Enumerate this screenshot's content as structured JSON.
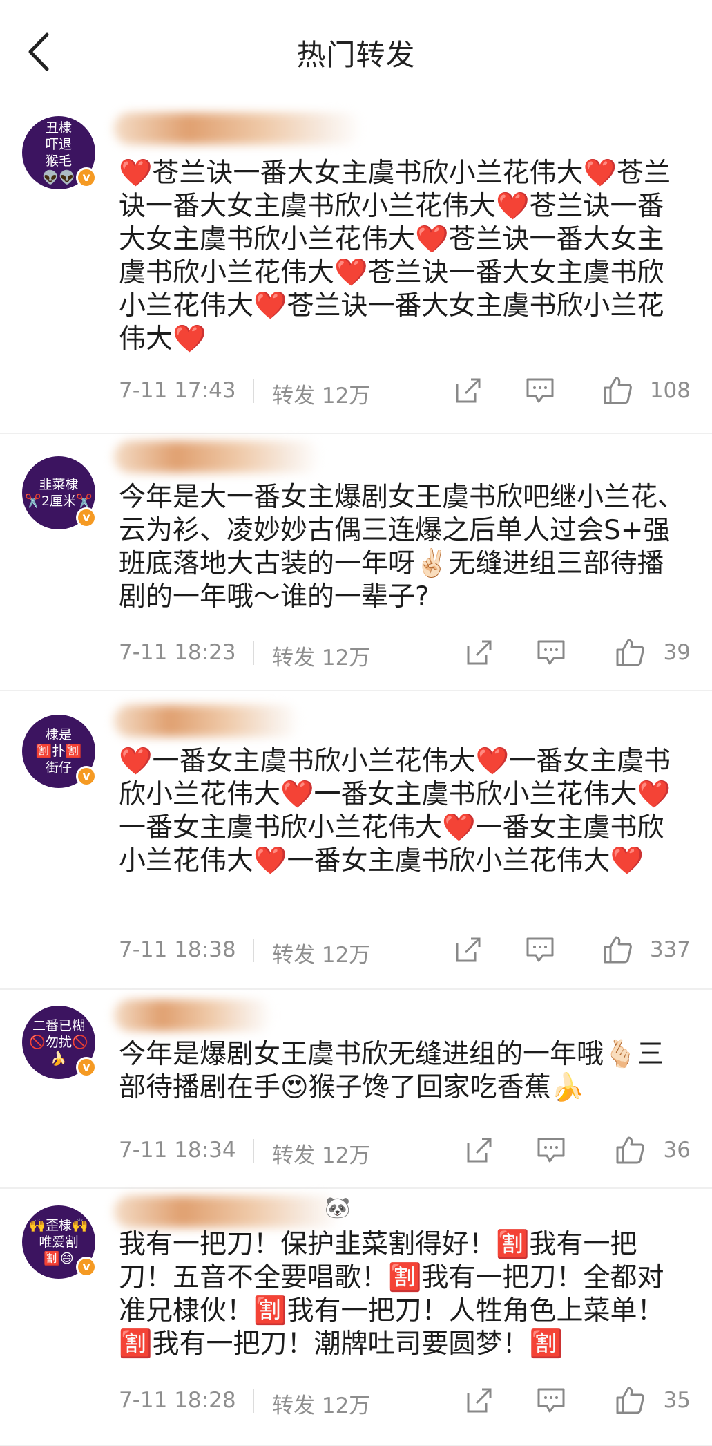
{
  "header": {
    "title": "热门转发"
  },
  "posts": [
    {
      "avatar": [
        "丑棣",
        "吓退",
        "猴毛",
        "👽👽"
      ],
      "text": "❤️苍兰诀一番大女主虞书欣小兰花伟大❤️苍兰诀一番大女主虞书欣小兰花伟大❤️苍兰诀一番大女主虞书欣小兰花伟大❤️苍兰诀一番大女主虞书欣小兰花伟大❤️苍兰诀一番大女主虞书欣小兰花伟大❤️苍兰诀一番大女主虞书欣小兰花伟大❤️",
      "time": "7-11 17:43",
      "repost": "转发 12万",
      "likes": "108"
    },
    {
      "avatar": [
        "韭菜棣",
        "✂️2厘米✂️"
      ],
      "text": "今年是大一番女主爆剧女王虞书欣吧继小兰花、云为衫、凌妙妙古偶三连爆之后单人过会S+强班底落地大古装的一年呀✌🏻无缝进组三部待播剧的一年哦～谁的一辈子?",
      "time": "7-11 18:23",
      "repost": "转发 12万",
      "likes": "39"
    },
    {
      "avatar": [
        "棣是",
        "🈹扑🈹",
        "街仔"
      ],
      "text": "❤️一番女主虞书欣小兰花伟大❤️一番女主虞书欣小兰花伟大❤️一番女主虞书欣小兰花伟大❤️一番女主虞书欣小兰花伟大❤️一番女主虞书欣小兰花伟大❤️一番女主虞书欣小兰花伟大❤️",
      "time": "7-11 18:38",
      "repost": "转发 12万",
      "likes": "337"
    },
    {
      "avatar": [
        "二番已糊",
        "🚫勿扰🚫",
        "🍌"
      ],
      "text": "今年是爆剧女王虞书欣无缝进组的一年哦🫰🏻三部待播剧在手😍猴子馋了回家吃香蕉🍌",
      "time": "7-11 18:34",
      "repost": "转发 12万",
      "likes": "36"
    },
    {
      "avatar": [
        "🙌歪棣🙌",
        "唯爱割",
        "🈹😄"
      ],
      "text": "我有一把刀！保护韭菜割得好！🈹我有一把刀！五音不全要唱歌！🈹我有一把刀！全都对准兄棣伙！🈹我有一把刀！人牲角色上菜单！🈹我有一把刀！潮牌吐司要圆梦！🈹",
      "time": "7-11 18:28",
      "repost": "转发 12万",
      "likes": "35"
    }
  ],
  "colors": {
    "accent_badge": "#f59a23",
    "avatar_bg": "#3c1460",
    "meta_text": "#8e8e8e",
    "heart": "#e8202d"
  },
  "icons": {
    "back": "chevron-left-icon",
    "share": "share-icon",
    "comment": "comment-icon",
    "like": "thumbs-up-icon",
    "verified": "verified-badge-icon"
  }
}
